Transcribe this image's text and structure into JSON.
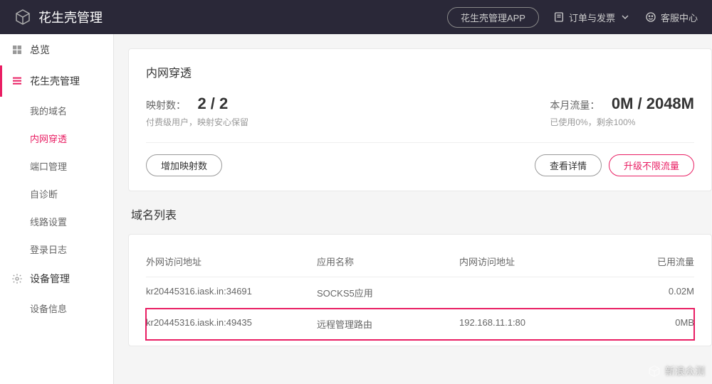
{
  "header": {
    "title": "花生壳管理",
    "app_btn": "花生壳管理APP",
    "orders": "订单与发票",
    "support": "客服中心"
  },
  "sidebar": {
    "overview": "总览",
    "hsk": "花生壳管理",
    "sub": {
      "domain": "我的域名",
      "nat": "内网穿透",
      "port": "端口管理",
      "diag": "自诊断",
      "route": "线路设置",
      "log": "登录日志"
    },
    "device": "设备管理",
    "device_info": "设备信息"
  },
  "panel": {
    "title": "内网穿透",
    "map_label": "映射数：",
    "map_value": "2 / 2",
    "map_sub": "付费级用户，映射安心保留",
    "add_map": "增加映射数",
    "traffic_label": "本月流量：",
    "traffic_value": "0M / 2048M",
    "traffic_sub": "已使用0%，剩余100%",
    "view_detail": "查看详情",
    "upgrade": "升级不限流量"
  },
  "list": {
    "title": "域名列表",
    "cols": {
      "c1": "外网访问地址",
      "c2": "应用名称",
      "c3": "内网访问地址",
      "c4": "已用流量"
    },
    "rows": [
      {
        "c1": "kr20445316.iask.in:34691",
        "c2": "SOCKS5应用",
        "c3": "",
        "c4": "0.02M"
      },
      {
        "c1": "kr20445316.iask.in:49435",
        "c2": "远程管理路由",
        "c3": "192.168.11.1:80",
        "c4": "0MB"
      }
    ]
  },
  "watermark": "新浪众测"
}
